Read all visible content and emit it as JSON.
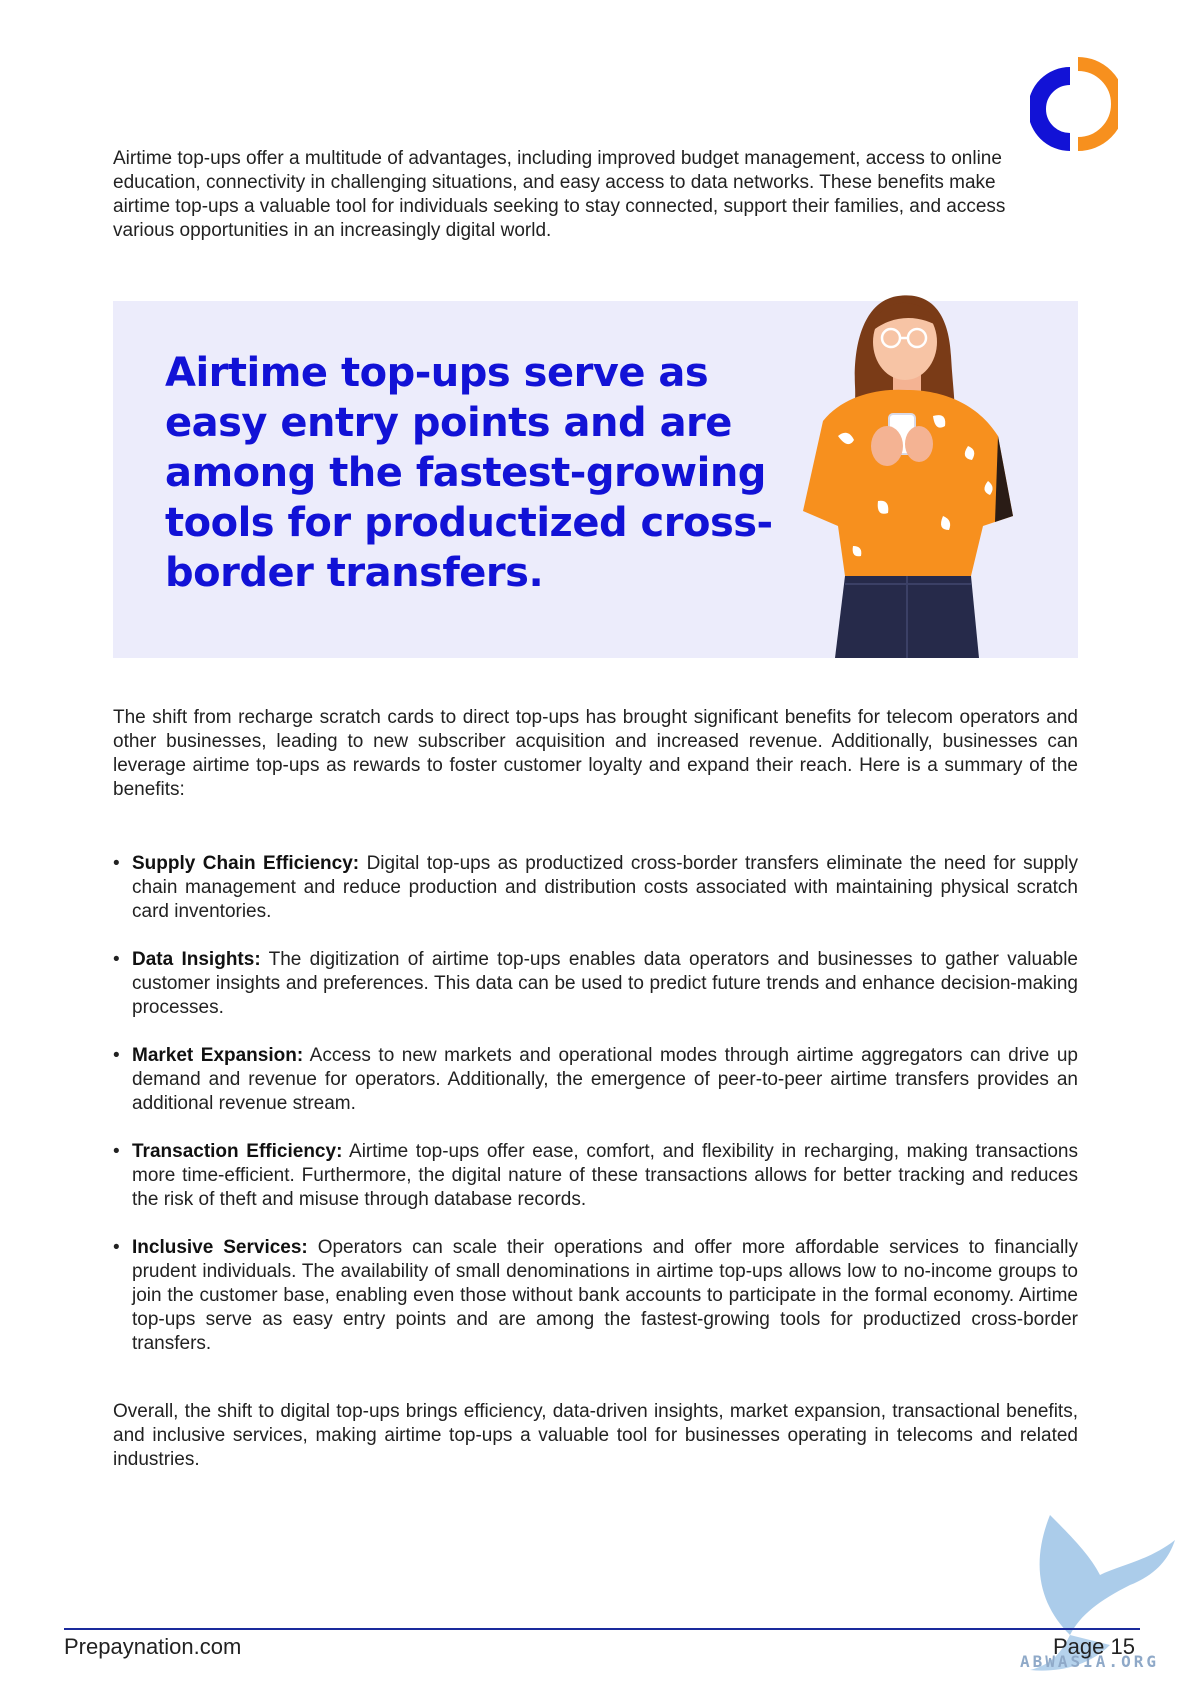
{
  "intro": "Airtime top-ups offer a multitude of advantages, including improved budget management, access to online education, connectivity in challenging situations, and easy access to data networks. These benefits make airtime top-ups a valuable tool for individuals seeking to stay connected, support their families, and access various opportunities in an increasingly digital world.",
  "callout": "Airtime top-ups serve as easy entry points and are among the fastest-growing tools for productized cross-border transfers.",
  "shift": "The shift from recharge scratch cards to direct top-ups has brought significant benefits for telecom operators and other businesses, leading to new subscriber acquisition and increased revenue. Additionally, businesses can leverage airtime top-ups as rewards to foster customer loyalty and expand their reach. Here is a summary of the benefits:",
  "bullet_glyph": "•",
  "benefits": [
    {
      "title": "Supply Chain Efficiency:",
      "text": " Digital top-ups as productized cross-border transfers eliminate the need for supply chain management and reduce production and distribution costs associated with maintaining physical scratch card inventories."
    },
    {
      "title": "Data Insights:",
      "text": " The digitization of airtime top-ups enables data operators and businesses to gather valuable customer insights and preferences. This data can be used to predict future trends and enhance decision-making processes."
    },
    {
      "title": "Market Expansion:",
      "text": " Access to new markets and operational modes through airtime aggregators can drive up demand and revenue for operators. Additionally, the emergence of peer-to-peer airtime transfers provides an additional revenue stream."
    },
    {
      "title": "Transaction Efficiency:",
      "text": " Airtime top-ups offer ease, comfort, and flexibility in recharging, making transactions more time-efficient. Furthermore, the digital nature of these transactions allows for better tracking and reduces the risk of theft and misuse through database records."
    },
    {
      "title": "Inclusive Services:",
      "text": " Operators can scale their operations and offer more affordable services to financially prudent individuals. The availability of small denominations in airtime top-ups allows low to no-income groups to join the customer base, enabling even those without bank accounts to participate in the formal economy. Airtime top-ups serve as easy entry points and are among the fastest-growing tools for productized cross-border transfers."
    }
  ],
  "conclusion": "Overall, the shift to digital top-ups brings efficiency, data-driven insights, market expansion, transactional benefits, and inclusive services, making airtime top-ups a valuable tool for businesses operating in telecoms and related industries.",
  "footer": {
    "site": "Prepaynation.com",
    "page": "Page 15"
  },
  "watermark": "ABWASIA.ORG",
  "colors": {
    "accent_blue": "#1212d6",
    "accent_orange": "#f7901e",
    "callout_bg": "#ececfb",
    "rule": "#1a2a9c"
  },
  "icons": {
    "logo": "prepaynation-logo-icon",
    "illustration": "woman-with-phone-illustration",
    "watermark": "bird-watermark-icon"
  }
}
